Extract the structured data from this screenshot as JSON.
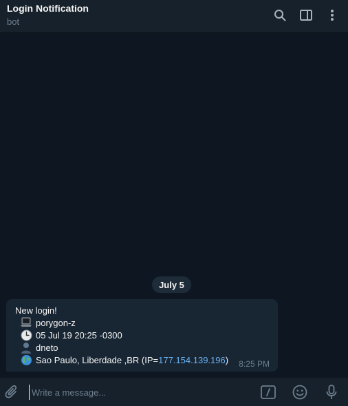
{
  "header": {
    "title": "Login Notification",
    "subtitle": "bot"
  },
  "chat": {
    "date_label": "July 5",
    "message": {
      "heading": "New login!",
      "lines": [
        {
          "icon": "laptop-icon",
          "text": "porygon-z"
        },
        {
          "icon": "clock-icon",
          "text": "05 Jul 19 20:25 -0300"
        },
        {
          "icon": "user-icon",
          "text": "dneto"
        },
        {
          "icon": "globe-icon",
          "text": "Sao Paulo, Liberdade ,BR (IP=",
          "link": "177.154.139.196",
          "suffix": ")"
        }
      ],
      "time": "8:25 PM"
    }
  },
  "composer": {
    "placeholder": "Write a message..."
  },
  "colors": {
    "background": "#0e1621",
    "header": "#17212b",
    "bubble": "#182533",
    "link": "#6ab3f3",
    "muted": "#6d7f8f"
  }
}
